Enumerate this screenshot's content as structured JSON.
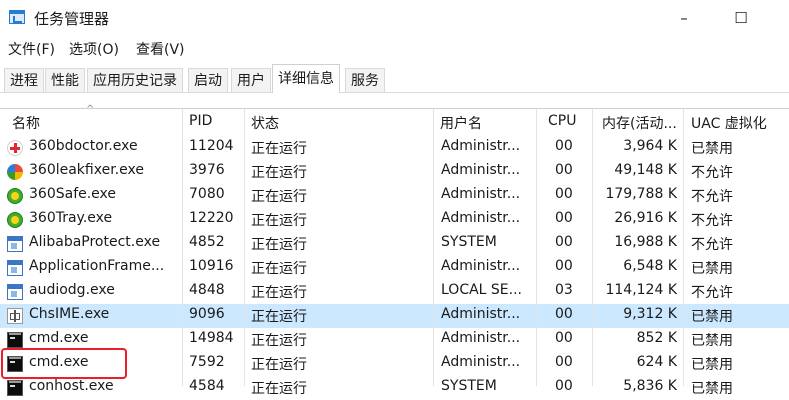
{
  "window": {
    "title": "任务管理器",
    "controls": {
      "minimize": "–",
      "maximize": "☐"
    }
  },
  "menu": [
    "文件(F)",
    "选项(O)",
    "查看(V)"
  ],
  "tabs": [
    "进程",
    "性能",
    "应用历史记录",
    "启动",
    "用户",
    "详细信息",
    "服务"
  ],
  "active_tab": "详细信息",
  "columns": {
    "name": "名称",
    "pid": "PID",
    "status": "状态",
    "user": "用户名",
    "cpu": "CPU",
    "memory": "内存(活动...",
    "uac": "UAC 虚拟化"
  },
  "sort_indicator": "^",
  "rows": [
    {
      "icon": "360-doctor-icon",
      "name": "360bdoctor.exe",
      "pid": "11204",
      "status": "正在运行",
      "user": "Administr...",
      "cpu": "00",
      "memory": "3,964 K",
      "uac": "已禁用"
    },
    {
      "icon": "360-leakfixer-icon",
      "name": "360leakfixer.exe",
      "pid": "3976",
      "status": "正在运行",
      "user": "Administr...",
      "cpu": "00",
      "memory": "49,148 K",
      "uac": "不允许"
    },
    {
      "icon": "360-safe-icon",
      "name": "360Safe.exe",
      "pid": "7080",
      "status": "正在运行",
      "user": "Administr...",
      "cpu": "00",
      "memory": "179,788 K",
      "uac": "不允许"
    },
    {
      "icon": "360-tray-icon",
      "name": "360Tray.exe",
      "pid": "12220",
      "status": "正在运行",
      "user": "Administr...",
      "cpu": "00",
      "memory": "26,916 K",
      "uac": "不允许"
    },
    {
      "icon": "window-app-icon",
      "name": "AlibabaProtect.exe",
      "pid": "4852",
      "status": "正在运行",
      "user": "SYSTEM",
      "cpu": "00",
      "memory": "16,988 K",
      "uac": "不允许"
    },
    {
      "icon": "window-app-icon",
      "name": "ApplicationFrame...",
      "pid": "10916",
      "status": "正在运行",
      "user": "Administr...",
      "cpu": "00",
      "memory": "6,548 K",
      "uac": "已禁用"
    },
    {
      "icon": "window-app-icon",
      "name": "audiodg.exe",
      "pid": "4848",
      "status": "正在运行",
      "user": "LOCAL SE...",
      "cpu": "03",
      "memory": "114,124 K",
      "uac": "不允许"
    },
    {
      "icon": "ime-icon",
      "name": "ChsIME.exe",
      "pid": "9096",
      "status": "正在运行",
      "user": "Administr...",
      "cpu": "00",
      "memory": "9,312 K",
      "uac": "已禁用"
    },
    {
      "icon": "cmd-icon",
      "name": "cmd.exe",
      "pid": "14984",
      "status": "正在运行",
      "user": "Administr...",
      "cpu": "00",
      "memory": "852 K",
      "uac": "已禁用"
    },
    {
      "icon": "cmd-icon",
      "name": "cmd.exe",
      "pid": "7592",
      "status": "正在运行",
      "user": "Administr...",
      "cpu": "00",
      "memory": "624 K",
      "uac": "已禁用"
    },
    {
      "icon": "cmd-icon",
      "name": "conhost.exe",
      "pid": "4584",
      "status": "正在运行",
      "user": "SYSTEM",
      "cpu": "00",
      "memory": "5,836 K",
      "uac": "已禁用"
    }
  ],
  "selected_row": 7,
  "highlighted_row": 9,
  "colors": {
    "selection": "#cce8ff",
    "highlight_box": "#e8202a"
  }
}
